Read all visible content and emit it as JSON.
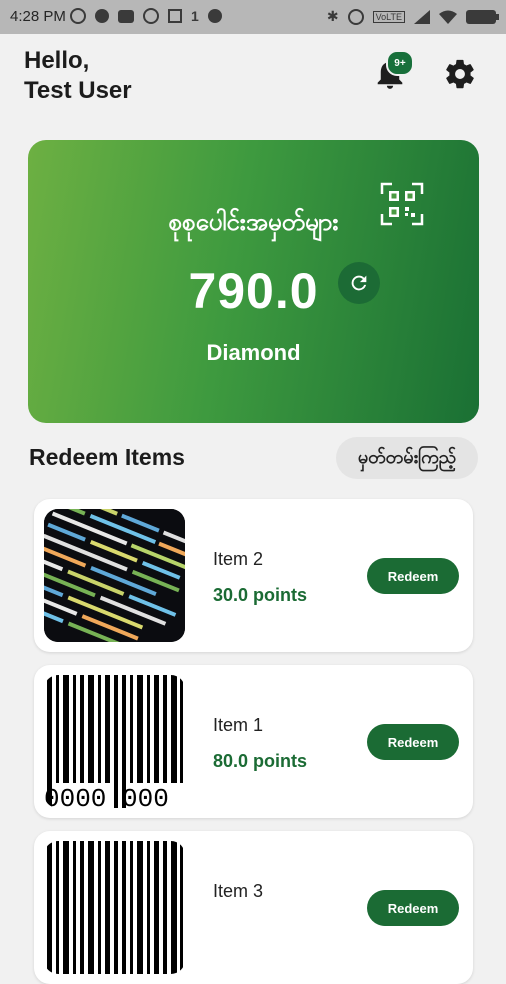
{
  "status_bar": {
    "time": "4:28 PM",
    "sim_label": "1",
    "volte": "VoLTE"
  },
  "header": {
    "greeting_line1": "Hello,",
    "greeting_line2": "Test User",
    "notification_badge": "9+",
    "icons": [
      "bell-icon",
      "gear-icon"
    ]
  },
  "points_card": {
    "title": "စုစုပေါင်းအမှတ်များ",
    "points": "790.0",
    "tier": "Diamond",
    "gradient_colors": [
      "#6db042",
      "#1a7034"
    ]
  },
  "redeem_section": {
    "title": "Redeem Items",
    "history_button": "မှတ်တမ်းကြည့်"
  },
  "items": [
    {
      "name": "Item 2",
      "points": "30.0 points",
      "redeem_label": "Redeem",
      "thumb": "code-screen"
    },
    {
      "name": "Item 1",
      "points": "80.0 points",
      "redeem_label": "Redeem",
      "thumb": "barcode",
      "barcode_text": "0000  000"
    },
    {
      "name": "Item 3",
      "points": "",
      "redeem_label": "Redeem",
      "thumb": "barcode"
    }
  ],
  "colors": {
    "accent": "#1b6b34",
    "background": "#f1f1f1"
  }
}
